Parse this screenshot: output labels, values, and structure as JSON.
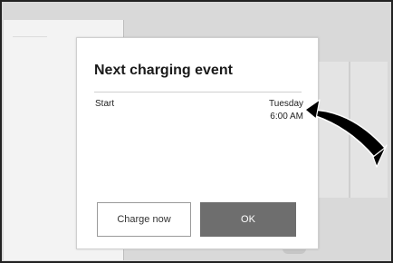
{
  "dialog": {
    "title": "Next charging event",
    "start_label": "Start",
    "start_day": "Tuesday",
    "start_time": "6:00 AM",
    "charge_now_label": "Charge now",
    "ok_label": "OK"
  },
  "annotation": {
    "callout_number": "",
    "arrow_icon": "callout-arrow"
  },
  "colors": {
    "ok_button": "#6e6e6e",
    "background": "#d9d9d9"
  }
}
